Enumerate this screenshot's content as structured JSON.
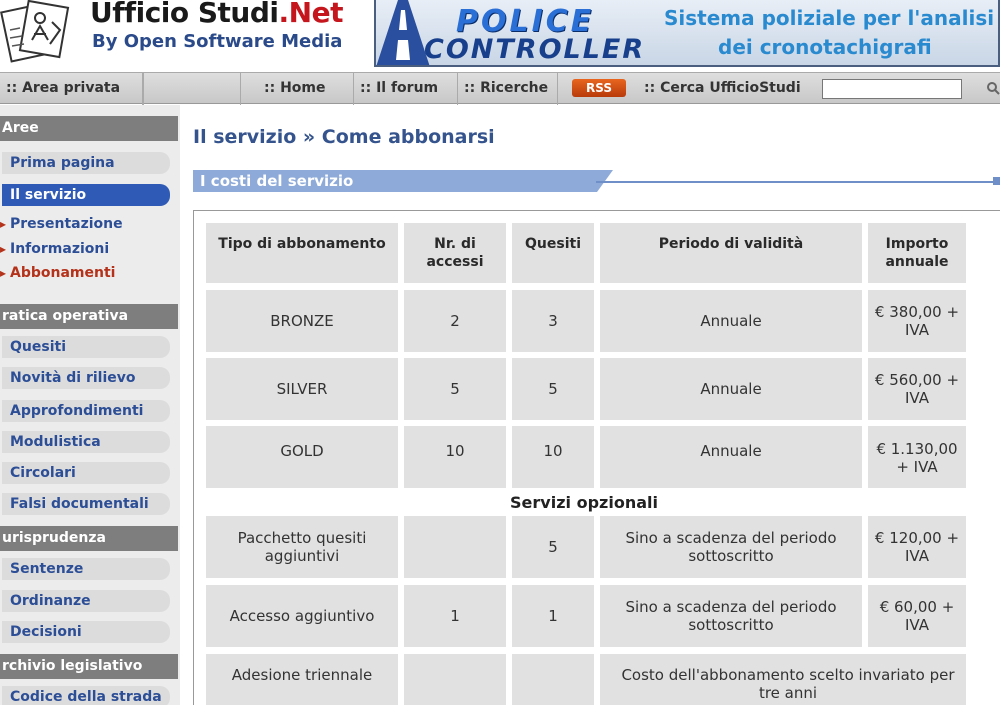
{
  "header": {
    "title_main": "Ufficio Studi",
    "title_net": ".Net",
    "subtitle": "By Open Software Media",
    "banner": {
      "logo_line1": "POLICE",
      "logo_line2": "CONTROLLER",
      "text_line1": "Sistema poliziale per l'analisi",
      "text_line2": "dei cronotachigrafi"
    }
  },
  "nav": {
    "items": [
      ":: Area privata",
      ":: Home",
      ":: Il forum",
      ":: Ricerche"
    ],
    "rss": "RSS",
    "search_label": ":: Cerca UfficioStudi",
    "search_value": ""
  },
  "sidebar": {
    "sections": [
      {
        "title": "Aree"
      },
      {
        "title": "ratica operativa"
      },
      {
        "title": "urisprudenza"
      },
      {
        "title": "rchivio legislativo"
      }
    ],
    "aree_items": [
      "Prima pagina",
      "Il servizio"
    ],
    "servizio_sub": [
      "Presentazione",
      "Informazioni",
      "Abbonamenti"
    ],
    "pratica_items": [
      "Quesiti",
      "Novità di rilievo",
      "Approfondimenti",
      "Modulistica",
      "Circolari",
      "Falsi documentali"
    ],
    "giuris_items": [
      "Sentenze",
      "Ordinanze",
      "Decisioni"
    ],
    "archivio_items": [
      "Codice della strada"
    ]
  },
  "main": {
    "breadcrumb": "Il servizio » Come abbonarsi",
    "section_title": "I costi del servizio",
    "table": {
      "headers": [
        "Tipo di abbonamento",
        "Nr. di accessi",
        "Quesiti",
        "Periodo di validità",
        "Importo annuale"
      ],
      "rows": [
        [
          "BRONZE",
          "2",
          "3",
          "Annuale",
          "€ 380,00 + IVA"
        ],
        [
          "SILVER",
          "5",
          "5",
          "Annuale",
          "€ 560,00 + IVA"
        ],
        [
          "GOLD",
          "10",
          "10",
          "Annuale",
          "€ 1.130,00 + IVA"
        ]
      ],
      "optional_title": "Servizi opzionali",
      "optional_rows": [
        [
          "Pacchetto quesiti aggiuntivi",
          "",
          "5",
          "Sino a scadenza del periodo sottoscritto",
          "€ 120,00 + IVA"
        ],
        [
          "Accesso aggiuntivo",
          "1",
          "1",
          "Sino a scadenza del periodo sottoscritto",
          "€ 60,00 + IVA"
        ],
        [
          "Adesione triennale",
          "",
          "",
          "Costo dell'abbonamento scelto invariato per tre anni"
        ]
      ]
    }
  },
  "colors": {
    "brand_red": "#c4161c",
    "link_blue": "#2c4e96",
    "active_blue": "#2f5ab5",
    "section_blue": "#6e8fc7",
    "cell_gray": "#e1e1e1"
  }
}
